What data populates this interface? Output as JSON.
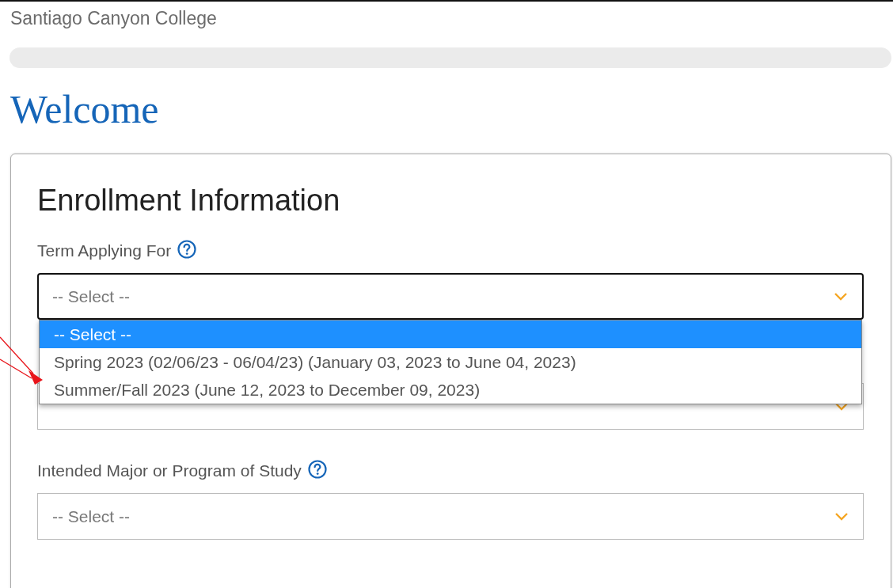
{
  "site_name": "Santiago Canyon College",
  "page_title": "Welcome",
  "card": {
    "title": "Enrollment Information",
    "fields": [
      {
        "label": "Term Applying For",
        "value": "-- Select --",
        "focused": true,
        "options": [
          {
            "label": "-- Select --",
            "selected": true
          },
          {
            "label": "Spring 2023 (02/06/23 - 06/04/23) (January 03, 2023 to June 04, 2023)",
            "selected": false
          },
          {
            "label": "Summer/Fall 2023 (June 12, 2023 to December 09, 2023)",
            "selected": false
          }
        ]
      },
      {
        "focused": false
      },
      {
        "label": "Intended Major or Program of Study",
        "value": "-- Select --",
        "focused": false
      }
    ]
  }
}
